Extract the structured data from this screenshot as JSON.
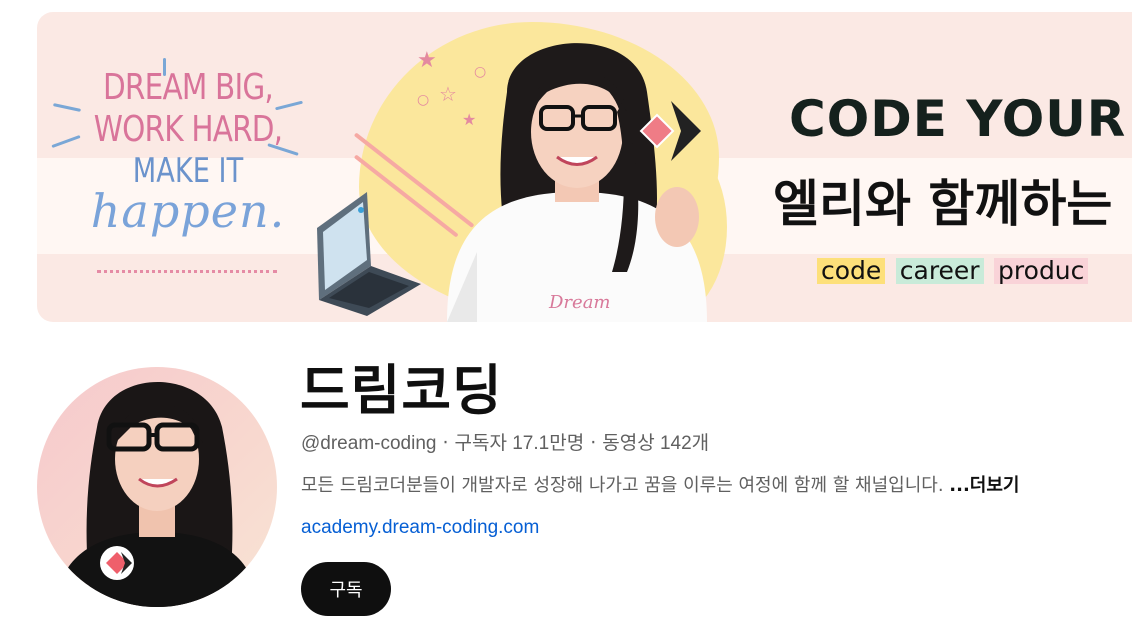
{
  "banner": {
    "motto_line1": "DREAM BIG,",
    "motto_line2": "WORK HARD,",
    "motto_line3": "MAKE IT",
    "motto_line4": "happen.",
    "shirt_text": "Dream",
    "title": "CODE YOUR",
    "subtitle": "엘리와 함께하는",
    "tags": [
      "code",
      "career",
      "produc"
    ],
    "tag_colors": [
      "#fde07a",
      "#c9ebd9",
      "#f9d3d8"
    ],
    "background_color": "#fbe9e4",
    "blob_color": "#fbe79c"
  },
  "channel": {
    "name": "드림코딩",
    "handle": "@dream-coding",
    "subscribers": "구독자 17.1만명",
    "videos": "동영상 142개",
    "separator": "‧",
    "description": "모든 드림코더분들이 개발자로 성장해 나가고 꿈을 이루는 여정에 함께 할 채널입니다.",
    "more": "...더보기",
    "link": "academy.dream-coding.com",
    "subscribe_label": "구독",
    "link_color": "#065fd4",
    "subscribe_color": "#0f0f0f"
  }
}
